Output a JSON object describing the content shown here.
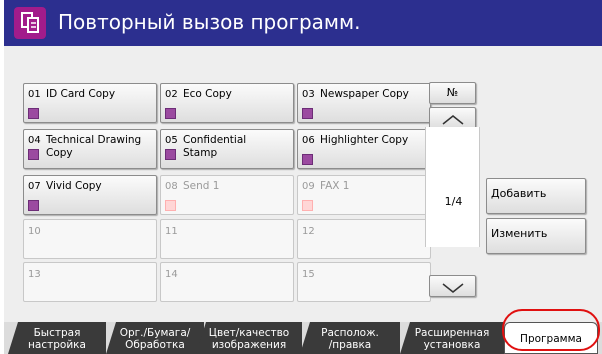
{
  "header": {
    "title": "Повторный вызов программ."
  },
  "programs": [
    {
      "num": "01",
      "name": "ID Card Copy",
      "enabled": true
    },
    {
      "num": "02",
      "name": "Eco Copy",
      "enabled": true
    },
    {
      "num": "03",
      "name": "Newspaper Copy",
      "enabled": true
    },
    {
      "num": "04",
      "name": "Technical Drawing\nCopy",
      "enabled": true
    },
    {
      "num": "05",
      "name": "Confidential\nStamp",
      "enabled": true
    },
    {
      "num": "06",
      "name": "Highlighter Copy",
      "enabled": true
    },
    {
      "num": "07",
      "name": "Vivid Copy",
      "enabled": true
    },
    {
      "num": "08",
      "name": "Send 1",
      "enabled": false
    },
    {
      "num": "09",
      "name": "FAX 1",
      "enabled": false
    },
    {
      "num": "10",
      "name": "",
      "enabled": false
    },
    {
      "num": "11",
      "name": "",
      "enabled": false
    },
    {
      "num": "12",
      "name": "",
      "enabled": false
    },
    {
      "num": "13",
      "name": "",
      "enabled": false
    },
    {
      "num": "14",
      "name": "",
      "enabled": false
    },
    {
      "num": "15",
      "name": "",
      "enabled": false
    }
  ],
  "side": {
    "number_label": "№",
    "page_indicator": "1/4"
  },
  "actions": {
    "add": "Добавить",
    "edit": "Изменить"
  },
  "tabs": [
    {
      "label": "Быстрая\nнастройка"
    },
    {
      "label": "Орг./Бумага/\nОбработка"
    },
    {
      "label": "Цвет/качество\nизображения"
    },
    {
      "label": "Располож.\n/правка"
    },
    {
      "label": "Расширенная\nустановка"
    },
    {
      "label": "Программа"
    }
  ]
}
